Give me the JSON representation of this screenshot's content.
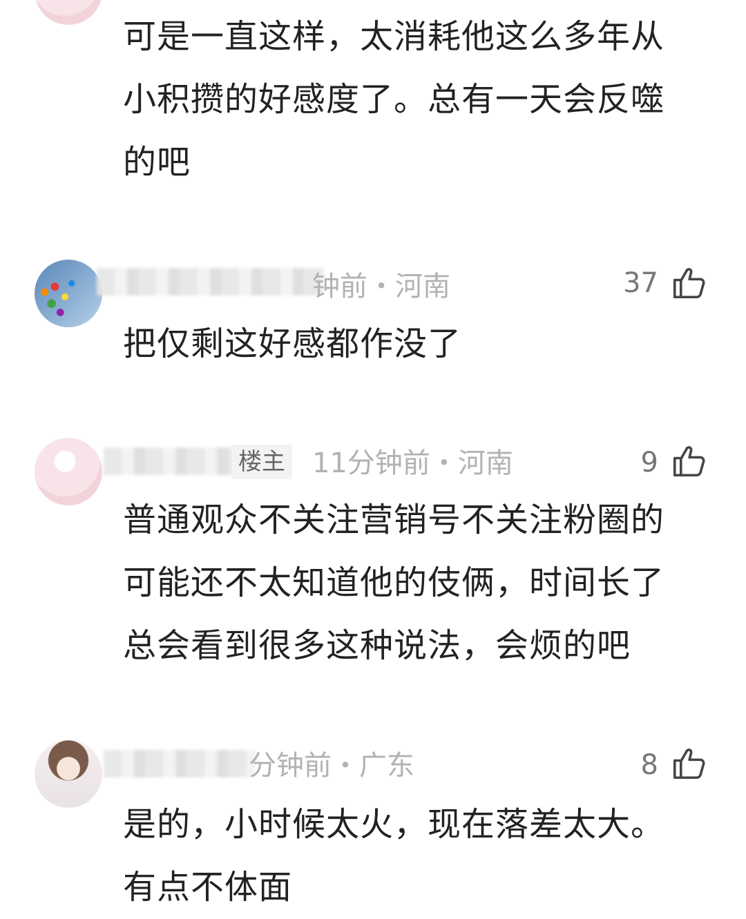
{
  "comments": [
    {
      "meta": "",
      "likes": "",
      "text_lines": [
        "可是一直这样，太消耗他这么多年从",
        "小积攒的好感度了。总有一天会反噬",
        "的吧"
      ]
    },
    {
      "meta": "钟前・河南",
      "likes": "37",
      "text_lines": [
        "把仅剩这好感都作没了"
      ]
    },
    {
      "badge": "楼主",
      "meta": "11分钟前・河南",
      "likes": "9",
      "text_lines": [
        "普通观众不关注营销号不关注粉圈的",
        "可能还不太知道他的伎俩，时间长了",
        "总会看到很多这种说法，会烦的吧"
      ]
    },
    {
      "meta": "分钟前・广东",
      "likes": "8",
      "text_lines": [
        "是的，小时候太火，现在落差太大。",
        "有点不体面"
      ]
    }
  ]
}
